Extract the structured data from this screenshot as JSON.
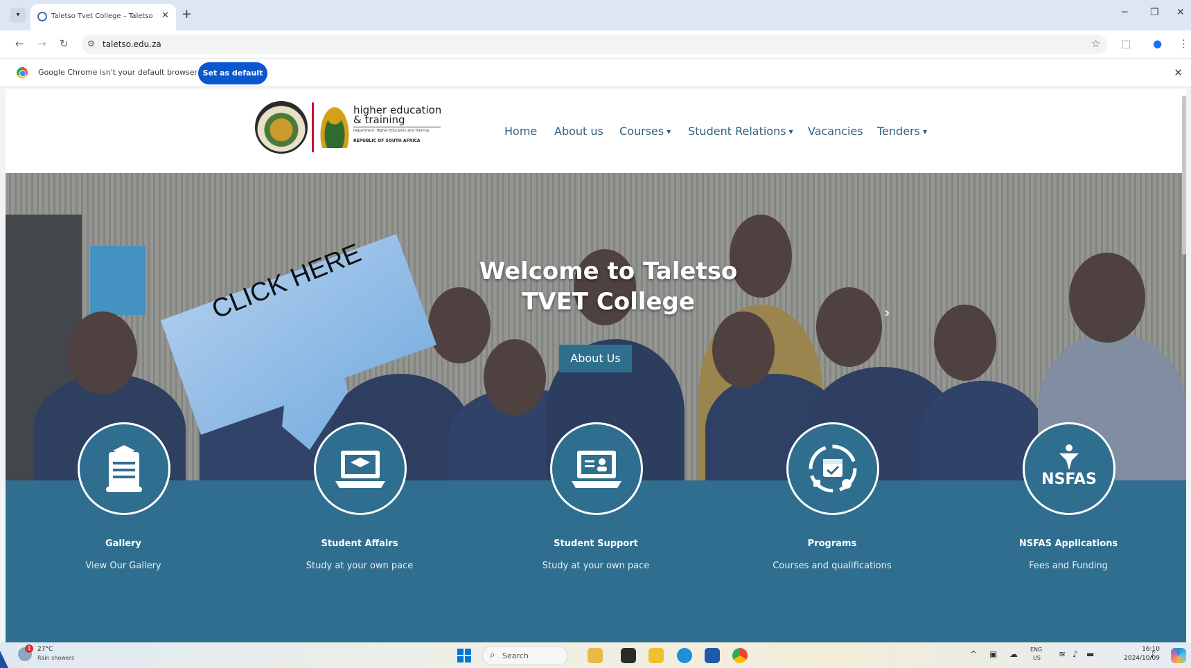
{
  "browser": {
    "tab_title": "Taletso Tvet College – Taletso T",
    "tab_close": "✕",
    "new_tab": "+",
    "url": "taletso.edu.za",
    "infobar_text": "Google Chrome isn't your default browser",
    "set_default_label": "Set as default",
    "close": "✕"
  },
  "site": {
    "logo_line1": "higher education",
    "logo_line2": "& training",
    "logo_small": "Department: Higher Education and Training",
    "logo_rsa": "REPUBLIC OF SOUTH AFRICA",
    "nav": [
      {
        "label": "Home"
      },
      {
        "label": "About us"
      },
      {
        "label": "Courses",
        "dropdown": true
      },
      {
        "label": "Student Relations",
        "dropdown": true
      },
      {
        "label": "Vacancies"
      },
      {
        "label": "Tenders",
        "dropdown": true
      }
    ],
    "hero_title_line1": "Welcome to Taletso",
    "hero_title_line2": "TVET College",
    "hero_button": "About Us",
    "callout": "CLICK HERE",
    "services": [
      {
        "title": "Gallery",
        "subtitle": "View Our Gallery",
        "icon": "scroll-certificate-icon"
      },
      {
        "title": "Student Affairs",
        "subtitle": "Study at your own pace",
        "icon": "laptop-graduation-cap-icon"
      },
      {
        "title": "Student Support",
        "subtitle": "Study at your own pace",
        "icon": "laptop-user-icon"
      },
      {
        "title": "Programs",
        "subtitle": "Courses and qualifications",
        "icon": "calendar-cycle-icon"
      },
      {
        "title": "NSFAS Applications",
        "subtitle": "Fees and Funding",
        "icon": "nsfas-logo-icon"
      }
    ],
    "nsfas_text": "NSFAS"
  },
  "taskbar": {
    "temp": "27°C",
    "weather": "Rain showers",
    "badge": "1",
    "search": "Search",
    "lang1": "ENG",
    "lang2": "US",
    "time": "16:10",
    "date": "2024/10/09"
  },
  "colors": {
    "teal": "#2f6e8e",
    "nav_text": "#2f5f7d",
    "chrome_blue": "#0b57d0"
  }
}
